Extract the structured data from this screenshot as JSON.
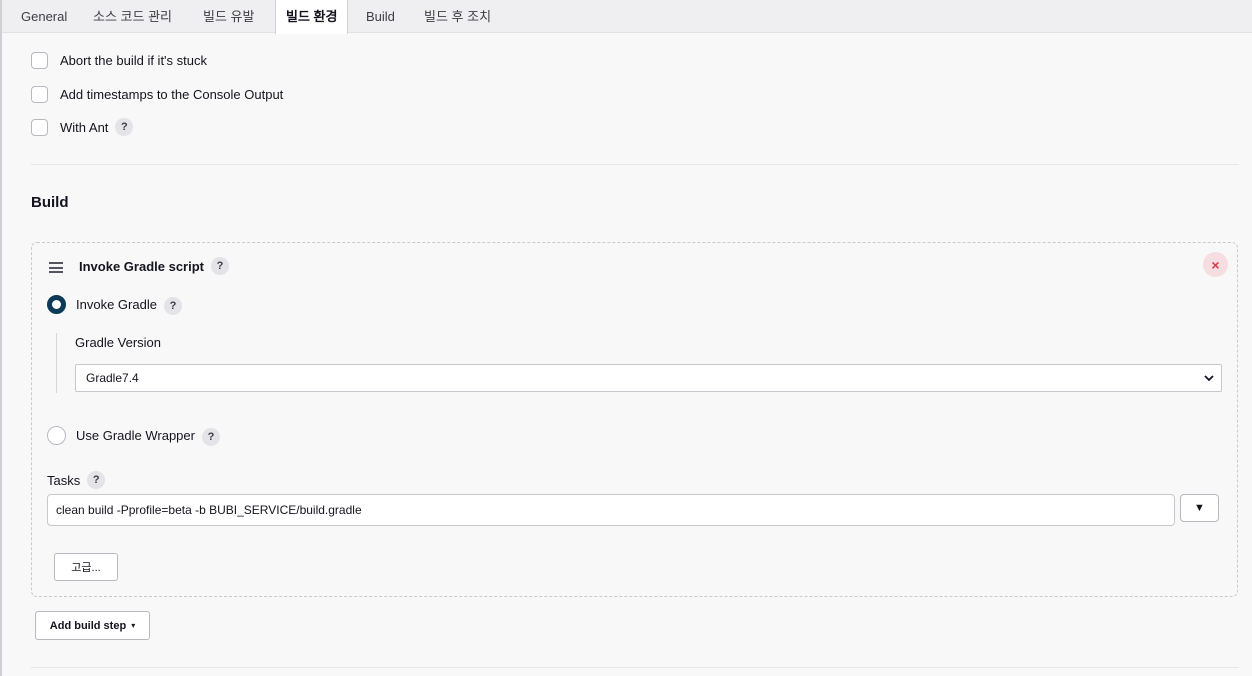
{
  "tabs": [
    {
      "label": "General"
    },
    {
      "label": "소스 코드 관리"
    },
    {
      "label": "빌드 유발"
    },
    {
      "label": "빌드 환경",
      "active": true
    },
    {
      "label": "Build"
    },
    {
      "label": "빌드 후 조치"
    }
  ],
  "build_env": {
    "options": [
      {
        "label": "Abort the build if it's stuck",
        "checked": false
      },
      {
        "label": "Add timestamps to the Console Output",
        "checked": false
      },
      {
        "label": "With Ant",
        "checked": false,
        "help": "?"
      }
    ]
  },
  "build": {
    "section_title": "Build",
    "step": {
      "title": "Invoke Gradle script",
      "help": "?",
      "close_icon": "×",
      "invoke_gradle": {
        "label": "Invoke Gradle",
        "selected": true,
        "help": "?"
      },
      "gradle_version": {
        "label": "Gradle Version",
        "value": "Gradle7.4"
      },
      "use_wrapper": {
        "label": "Use Gradle Wrapper",
        "selected": false,
        "help": "?"
      },
      "tasks": {
        "label": "Tasks",
        "help": "?",
        "value": "clean build -Pprofile=beta -b BUBI_SERVICE/build.gradle",
        "expand_icon": "▼"
      },
      "advanced_button": "고급..."
    },
    "add_build_step": "Add build step",
    "add_build_step_caret": "▾"
  },
  "colors": {
    "background": "#f8f8f8",
    "radio_selected": "#0d3a56",
    "close_button_bg": "#f6dde0",
    "close_button_fg": "#d23c48"
  }
}
